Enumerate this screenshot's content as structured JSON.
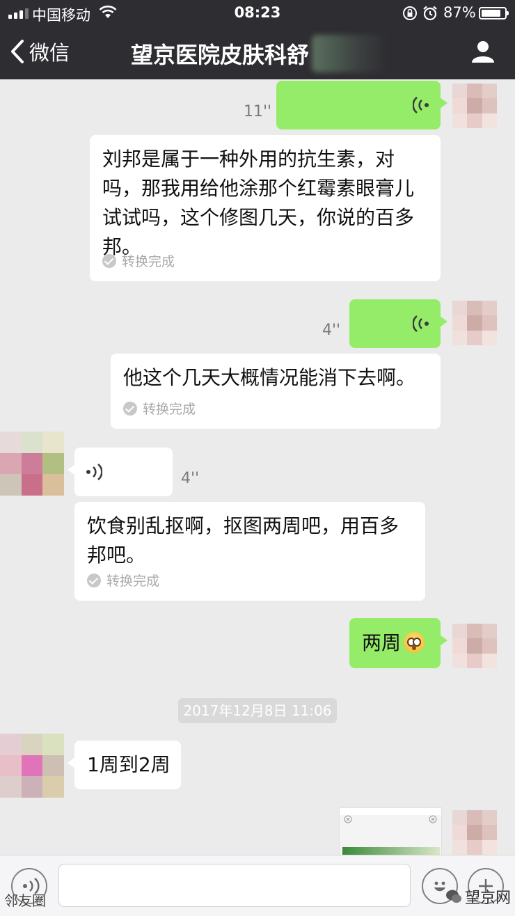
{
  "status_bar": {
    "carrier": "中国移动",
    "time": "08:23",
    "battery_percent_label": "87%",
    "battery_level": 0.87
  },
  "nav": {
    "back_label": "微信",
    "title": "望京医院皮肤科舒"
  },
  "messages": [
    {
      "type": "voice",
      "side": "right",
      "duration": "11''"
    },
    {
      "type": "voice-transcript",
      "side": "right",
      "text": "刘邦是属于一种外用的抗生素，对吗，那我用给他涂那个红霉素眼膏儿试试吗，这个修图几天，你说的百多邦。",
      "status": "转换完成"
    },
    {
      "type": "voice",
      "side": "right",
      "duration": "4''"
    },
    {
      "type": "voice-transcript",
      "side": "right",
      "text": "他这个几天大概情况能消下去啊。",
      "status": "转换完成"
    },
    {
      "type": "voice",
      "side": "left",
      "duration": "4''"
    },
    {
      "type": "voice-transcript",
      "side": "left",
      "text": "饮食别乱抠啊，抠图两周吧，用百多邦吧。",
      "status": "转换完成"
    },
    {
      "type": "text",
      "side": "right",
      "text": "两周",
      "emoji": "astonished-face"
    },
    {
      "type": "timestamp",
      "text": "2017年12月8日 11:06"
    },
    {
      "type": "text",
      "side": "left",
      "text": "1周到2周"
    },
    {
      "type": "image",
      "side": "right"
    }
  ],
  "watermarks": {
    "left": "邻友圈",
    "right": "望京网"
  },
  "icons": {
    "back": "chevron-left-icon",
    "profile": "person-icon",
    "voice_toggle": "voice-input-icon",
    "emoji": "emoji-icon"
  },
  "colors": {
    "nav_bg": "#2e2d32",
    "chat_bg": "#ebebeb",
    "self_bubble": "#95ec69",
    "other_bubble": "#ffffff"
  }
}
